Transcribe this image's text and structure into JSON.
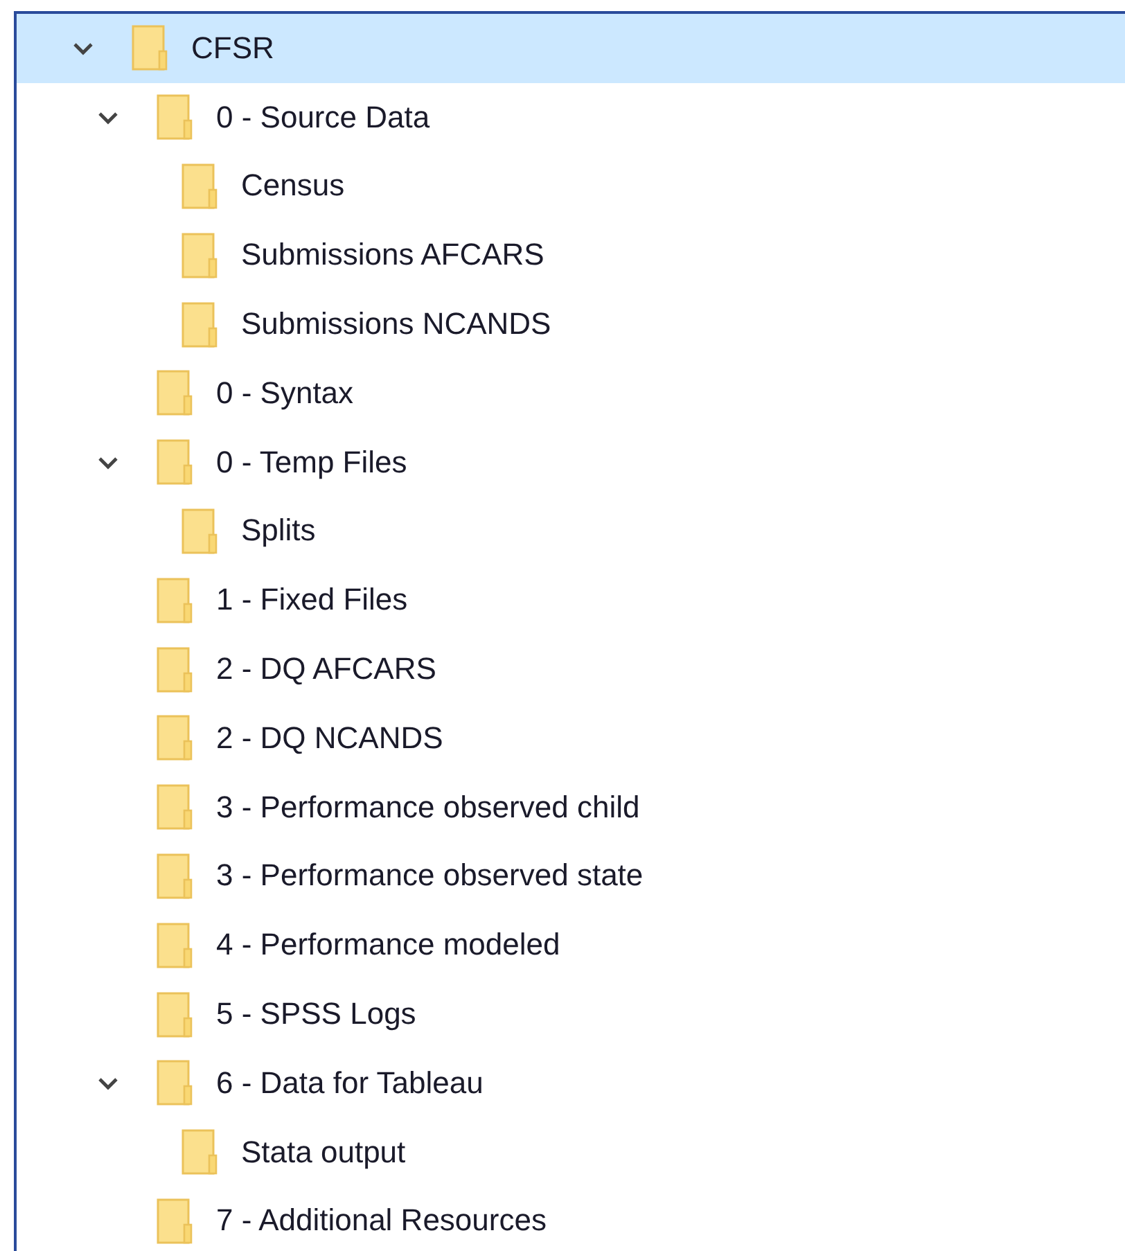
{
  "tree": [
    {
      "name": "CFSR",
      "selected": true,
      "expanded": true,
      "children": [
        {
          "name": "0 - Source Data",
          "selected": false,
          "expanded": true,
          "children": [
            {
              "name": "Census",
              "selected": false
            },
            {
              "name": "Submissions AFCARS",
              "selected": false
            },
            {
              "name": "Submissions NCANDS",
              "selected": false
            }
          ]
        },
        {
          "name": "0 - Syntax",
          "selected": false
        },
        {
          "name": "0 - Temp Files",
          "selected": false,
          "expanded": true,
          "children": [
            {
              "name": "Splits",
              "selected": false
            }
          ]
        },
        {
          "name": "1 - Fixed Files",
          "selected": false
        },
        {
          "name": "2 - DQ AFCARS",
          "selected": false
        },
        {
          "name": "2 - DQ NCANDS",
          "selected": false
        },
        {
          "name": "3 - Performance observed child",
          "selected": false
        },
        {
          "name": "3 - Performance observed state",
          "selected": false
        },
        {
          "name": "4 - Performance modeled",
          "selected": false
        },
        {
          "name": "5 - SPSS Logs",
          "selected": false
        },
        {
          "name": "6 - Data for Tableau",
          "selected": false,
          "expanded": true,
          "children": [
            {
              "name": "Stata output",
              "selected": false
            }
          ]
        },
        {
          "name": "7 - Additional Resources",
          "selected": false
        }
      ]
    }
  ]
}
